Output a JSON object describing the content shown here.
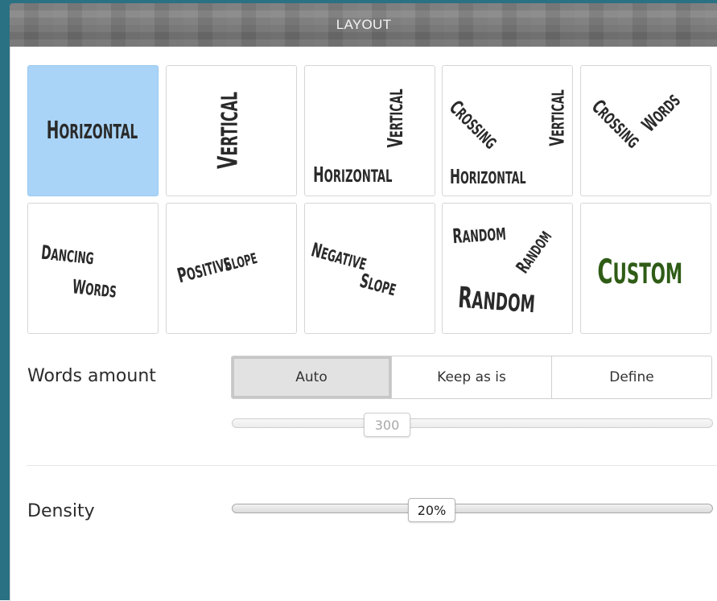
{
  "header": {
    "title": "LAYOUT"
  },
  "layout_options": {
    "horizontal": {
      "words": [
        "Horizontal"
      ],
      "selected": true
    },
    "vertical": {
      "words": [
        "Vertical"
      ]
    },
    "vertical_horizontal": {
      "words": [
        "Vertical",
        "Horizontal"
      ]
    },
    "crossing_vertical": {
      "words": [
        "Crossing",
        "Vertical",
        "Horizontal"
      ]
    },
    "crossing_words": {
      "words": [
        "Crossing",
        "Words"
      ]
    },
    "dancing_words": {
      "words": [
        "Dancing",
        "Words"
      ]
    },
    "positive_slope": {
      "words": [
        "Positive",
        "Slope"
      ]
    },
    "negative_slope": {
      "words": [
        "Negative",
        "Slope"
      ]
    },
    "random": {
      "words": [
        "Random",
        "Random",
        "Random"
      ]
    },
    "custom": {
      "words": [
        "Custom"
      ],
      "color": "#2f5c16"
    }
  },
  "words_amount": {
    "label": "Words amount",
    "options": [
      "Auto",
      "Keep as is",
      "Define"
    ],
    "selected": "Auto",
    "slider_value": "300",
    "slider_enabled": false
  },
  "density": {
    "label": "Density",
    "slider_value": "20%"
  },
  "colors": {
    "frame": "#2b7184",
    "selected_tile": "#a9d4f7",
    "custom_word": "#2f5c16"
  }
}
